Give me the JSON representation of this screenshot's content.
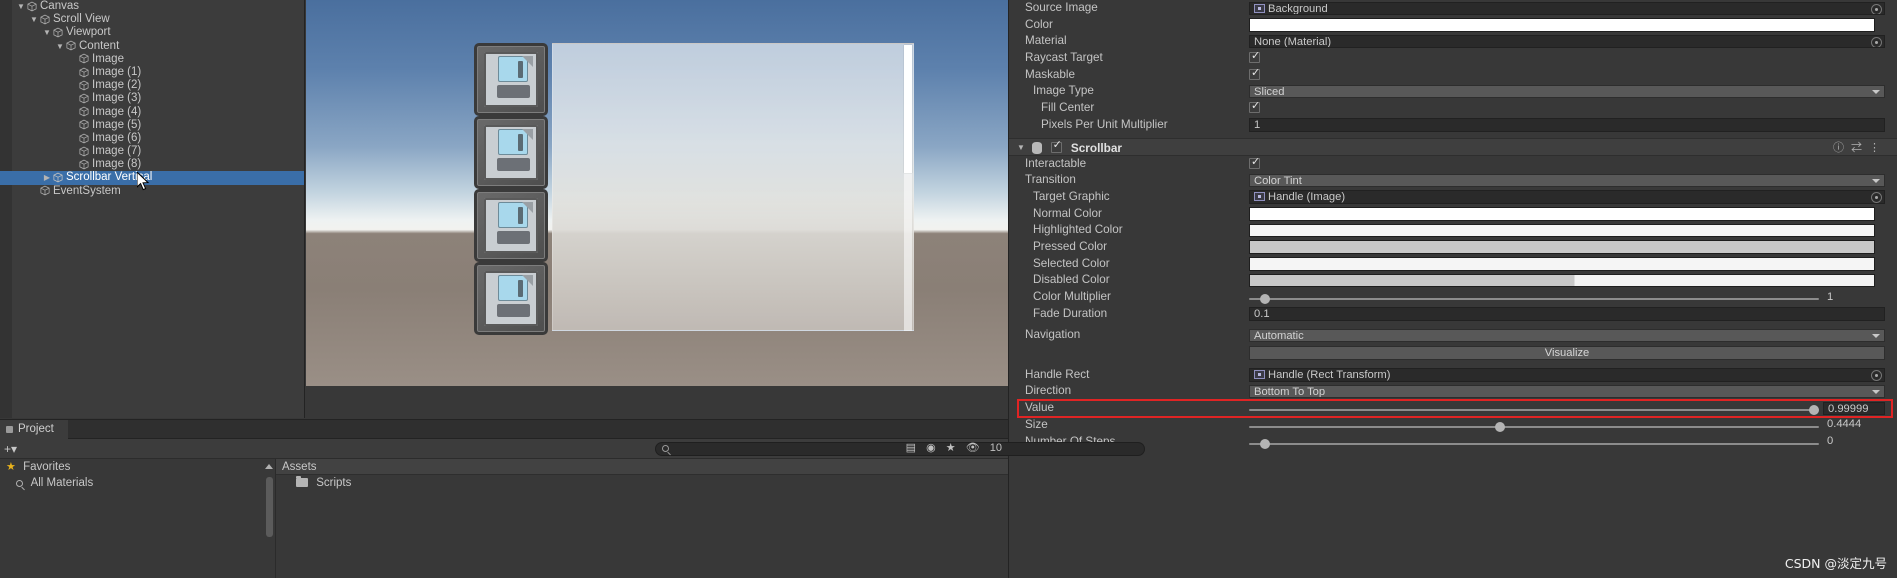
{
  "hierarchy": {
    "items": [
      {
        "label": "Canvas",
        "depth": 1,
        "tri": "▼",
        "selected": false
      },
      {
        "label": "Scroll View",
        "depth": 2,
        "tri": "▼",
        "selected": false
      },
      {
        "label": "Viewport",
        "depth": 3,
        "tri": "▼",
        "selected": false
      },
      {
        "label": "Content",
        "depth": 4,
        "tri": "▼",
        "selected": false
      },
      {
        "label": "Image",
        "depth": 5,
        "tri": "",
        "selected": false
      },
      {
        "label": "Image (1)",
        "depth": 5,
        "tri": "",
        "selected": false
      },
      {
        "label": "Image (2)",
        "depth": 5,
        "tri": "",
        "selected": false
      },
      {
        "label": "Image (3)",
        "depth": 5,
        "tri": "",
        "selected": false
      },
      {
        "label": "Image (4)",
        "depth": 5,
        "tri": "",
        "selected": false
      },
      {
        "label": "Image (5)",
        "depth": 5,
        "tri": "",
        "selected": false
      },
      {
        "label": "Image (6)",
        "depth": 5,
        "tri": "",
        "selected": false
      },
      {
        "label": "Image (7)",
        "depth": 5,
        "tri": "",
        "selected": false
      },
      {
        "label": "Image (8)",
        "depth": 5,
        "tri": "",
        "selected": false
      },
      {
        "label": "Scrollbar Vertical",
        "depth": 3,
        "tri": "▶",
        "selected": true
      },
      {
        "label": "EventSystem",
        "depth": 2,
        "tri": "",
        "selected": false
      }
    ]
  },
  "inspector": {
    "image_section": {
      "source_image_label": "Source Image",
      "source_image_value": "Background",
      "color_label": "Color",
      "color_value": "#ffffff",
      "material_label": "Material",
      "material_value": "None (Material)",
      "raycast_target_label": "Raycast Target",
      "raycast_target_checked": true,
      "maskable_label": "Maskable",
      "maskable_checked": true,
      "image_type_label": "Image Type",
      "image_type_value": "Sliced",
      "fill_center_label": "Fill Center",
      "fill_center_checked": true,
      "pixels_per_unit_label": "Pixels Per Unit Multiplier",
      "pixels_per_unit_value": "1"
    },
    "scrollbar_component": {
      "title": "Scrollbar",
      "enabled": true,
      "help_icon": "help-icon",
      "preset_icon": "preset-icon",
      "menu_icon": "kebab-menu-icon",
      "interactable_label": "Interactable",
      "interactable_checked": true,
      "transition_label": "Transition",
      "transition_value": "Color Tint",
      "target_graphic_label": "Target Graphic",
      "target_graphic_value": "Handle (Image)",
      "normal_color_label": "Normal Color",
      "normal_color_value": "#ffffff",
      "highlighted_color_label": "Highlighted Color",
      "highlighted_color_value": "#f5f5f5",
      "pressed_color_label": "Pressed Color",
      "pressed_color_value": "#c8c8c8",
      "selected_color_label": "Selected Color",
      "selected_color_value": "#f5f5f5",
      "disabled_color_label": "Disabled Color",
      "disabled_color_value": "#c8c8c8",
      "color_multiplier_label": "Color Multiplier",
      "color_multiplier_value": "1",
      "color_multiplier_pct": 2,
      "fade_duration_label": "Fade Duration",
      "fade_duration_value": "0.1",
      "navigation_label": "Navigation",
      "navigation_value": "Automatic",
      "visualize_label": "Visualize",
      "handle_rect_label": "Handle Rect",
      "handle_rect_value": "Handle (Rect Transform)",
      "direction_label": "Direction",
      "direction_value": "Bottom To Top",
      "value_label": "Value",
      "value_value": "0.99999",
      "value_pct": 100,
      "size_label": "Size",
      "size_value": "0.4444",
      "size_pct": 44,
      "number_of_steps_label": "Number Of Steps",
      "number_of_steps_value": "0",
      "number_of_steps_pct": 2
    }
  },
  "project": {
    "tab_label": "Project",
    "search_placeholder": "",
    "search_value": "",
    "asset_count": "10",
    "favorites_label": "Favorites",
    "all_materials_label": "All Materials",
    "assets_label": "Assets",
    "scripts_label": "Scripts"
  },
  "watermark": {
    "text": "CSDN @淡定九号"
  },
  "colors": {
    "selection_blue": "#3a6ea8",
    "highlight_red": "#e02424",
    "panel_bg": "#383838"
  }
}
